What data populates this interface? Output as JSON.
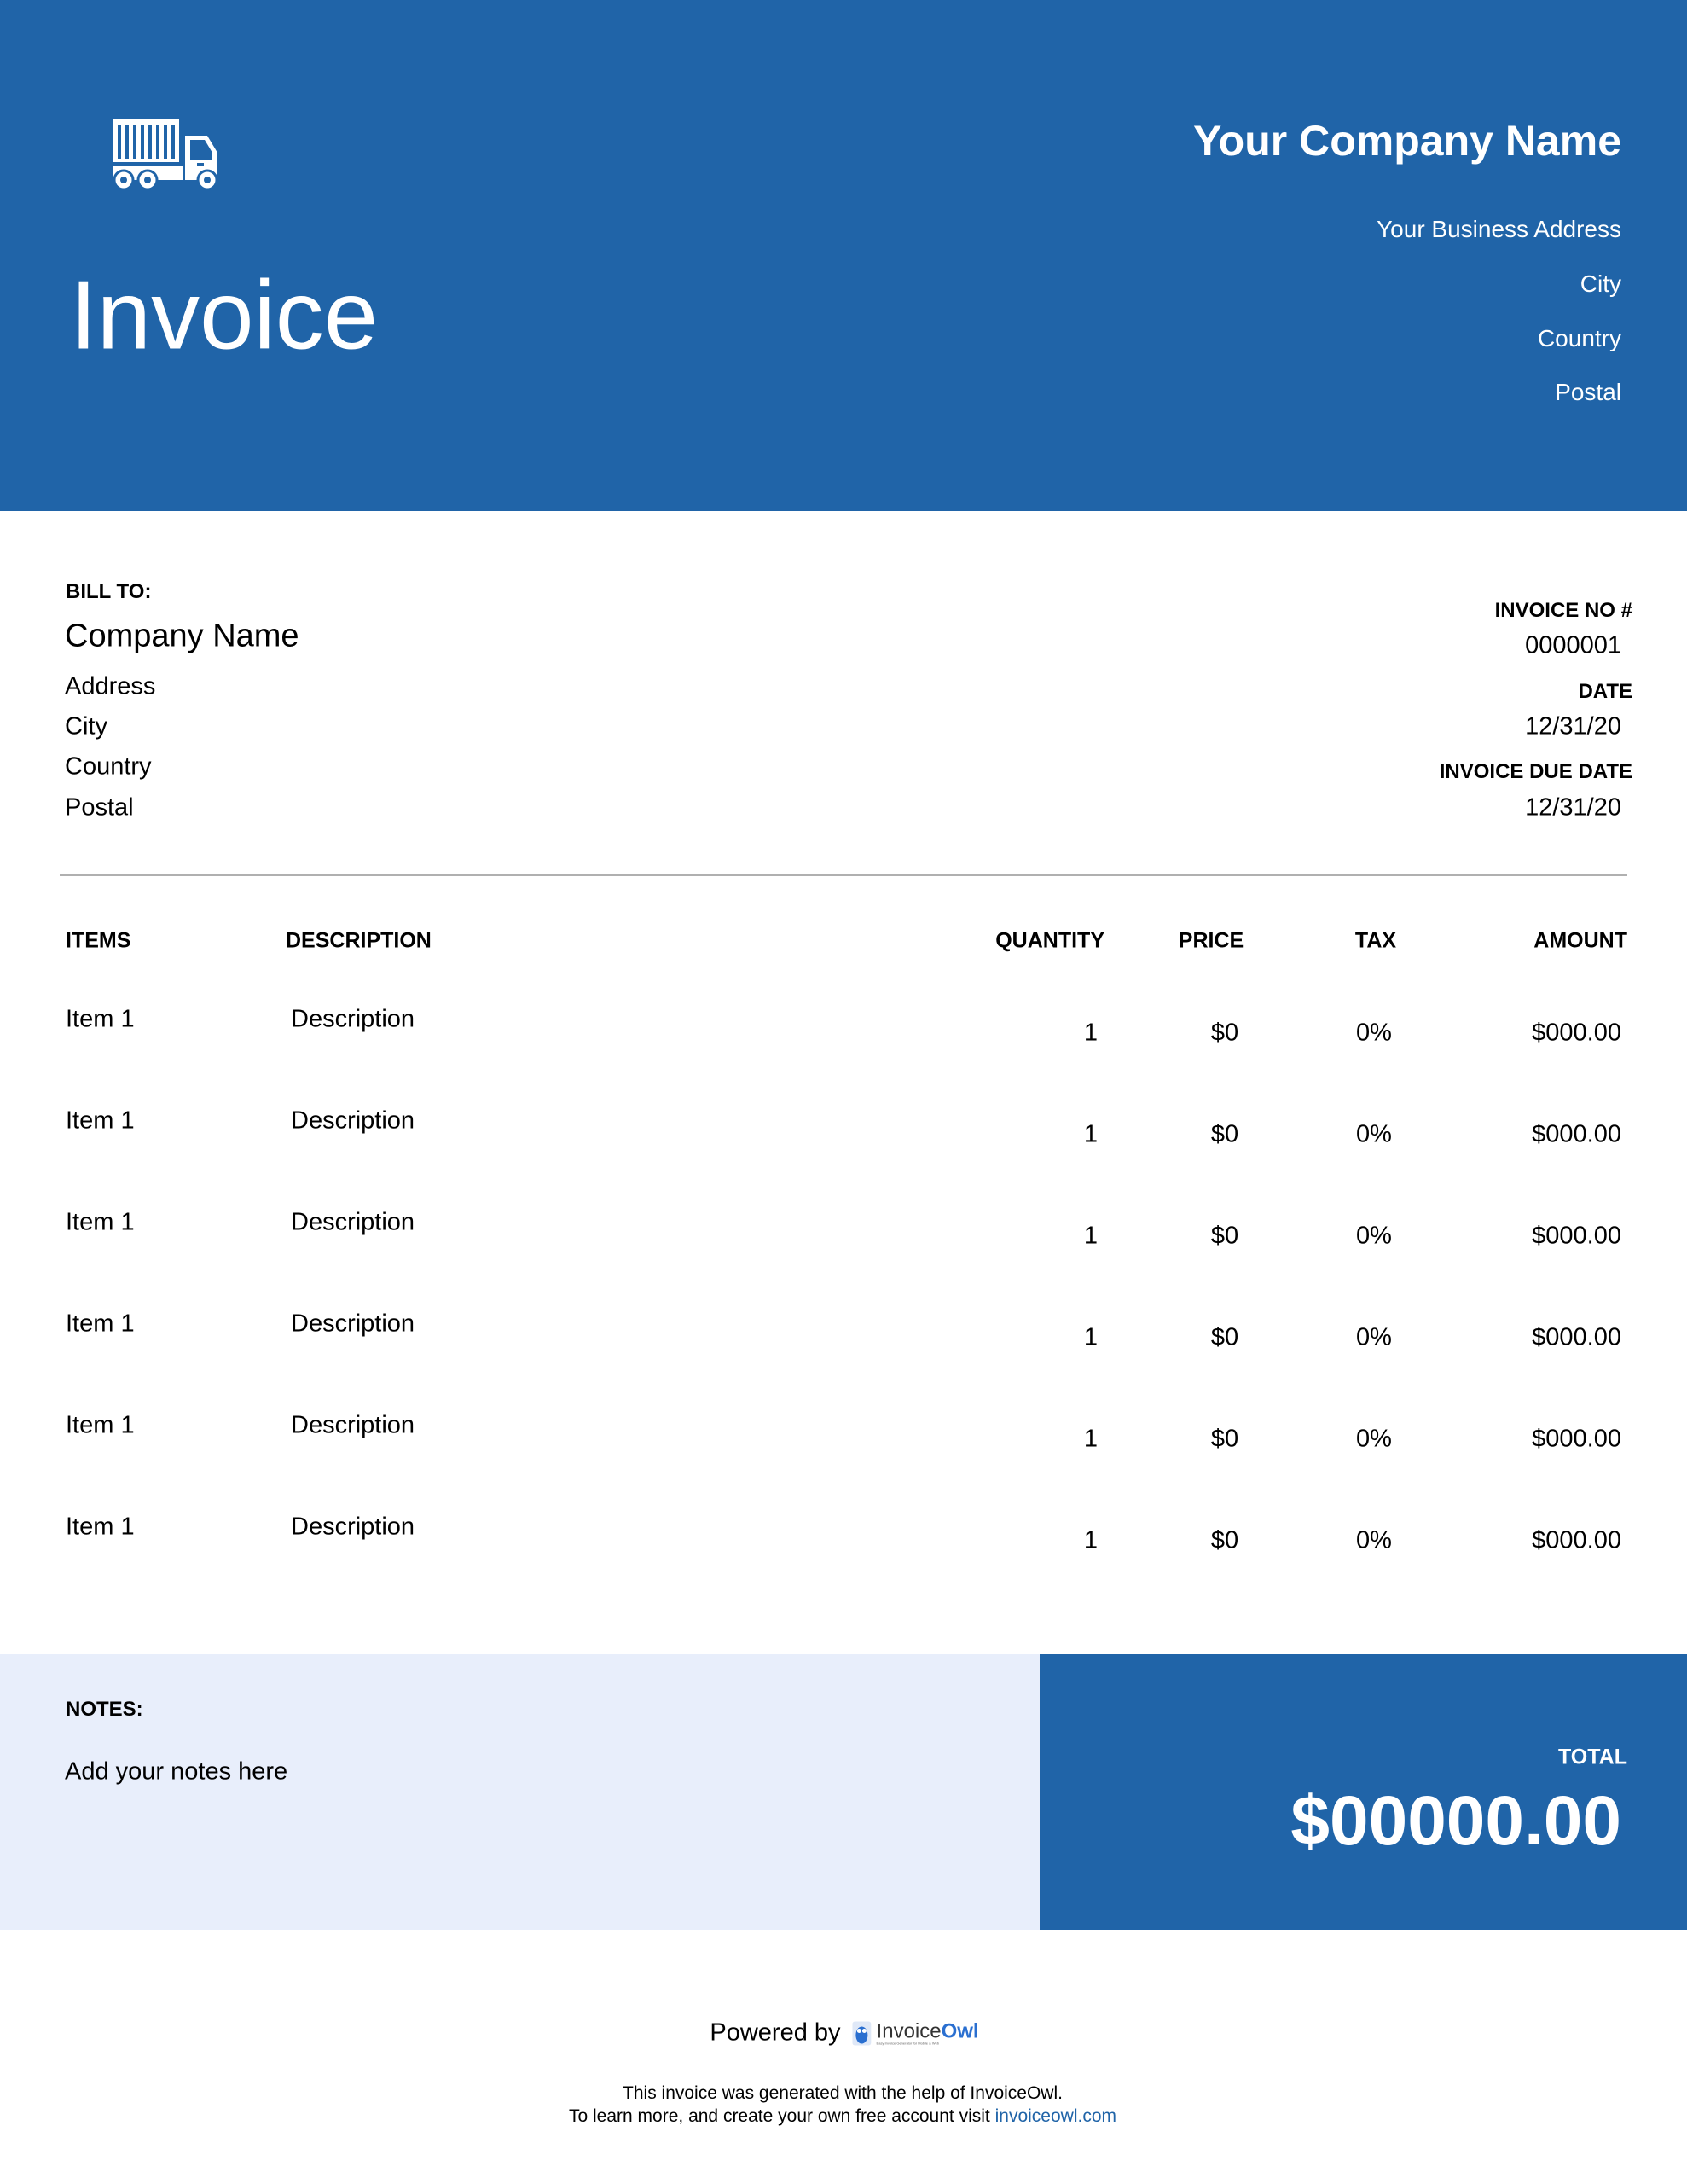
{
  "header": {
    "logo_icon": "truck-icon",
    "title": "Invoice",
    "company_name": "Your Company Name",
    "address_lines": [
      "Your Business Address",
      "City",
      "Country",
      "Postal"
    ]
  },
  "bill_to": {
    "label": "BILL TO:",
    "company": "Company Name",
    "lines": [
      "Address",
      "City",
      "Country",
      "Postal"
    ]
  },
  "meta": {
    "invoice_no_label": "INVOICE NO #",
    "invoice_no": "0000001",
    "date_label": "DATE",
    "date": "12/31/20",
    "due_label": "INVOICE DUE DATE",
    "due": "12/31/20"
  },
  "table": {
    "headers": [
      "ITEMS",
      "DESCRIPTION",
      "QUANTITY",
      "PRICE",
      "TAX",
      "AMOUNT"
    ],
    "rows": [
      {
        "item": "Item 1",
        "description": "Description",
        "quantity": "1",
        "price": "$0",
        "tax": "0%",
        "amount": "$000.00"
      },
      {
        "item": "Item 1",
        "description": "Description",
        "quantity": "1",
        "price": "$0",
        "tax": "0%",
        "amount": "$000.00"
      },
      {
        "item": "Item 1",
        "description": "Description",
        "quantity": "1",
        "price": "$0",
        "tax": "0%",
        "amount": "$000.00"
      },
      {
        "item": "Item 1",
        "description": "Description",
        "quantity": "1",
        "price": "$0",
        "tax": "0%",
        "amount": "$000.00"
      },
      {
        "item": "Item 1",
        "description": "Description",
        "quantity": "1",
        "price": "$0",
        "tax": "0%",
        "amount": "$000.00"
      },
      {
        "item": "Item 1",
        "description": "Description",
        "quantity": "1",
        "price": "$0",
        "tax": "0%",
        "amount": "$000.00"
      }
    ]
  },
  "notes": {
    "label": "NOTES:",
    "text": "Add your notes here"
  },
  "total": {
    "label": "TOTAL",
    "value": "$00000.00"
  },
  "footer": {
    "powered_by": "Powered by",
    "brand_invoice": "Invoice",
    "brand_owl": "Owl",
    "brand_tagline": "Easy Invoice Generator for Mobile & Web",
    "line1": "This invoice was generated with the help of InvoiceOwl.",
    "line2": "To learn more, and create your own free account visit",
    "link": "invoiceowl.com"
  },
  "colors": {
    "primary": "#2064a8",
    "notes_bg": "#e8eefb"
  }
}
